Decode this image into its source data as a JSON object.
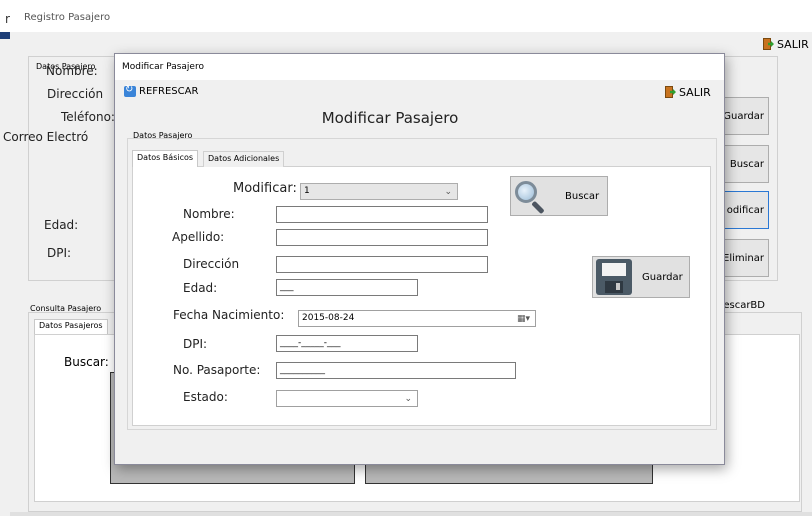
{
  "background_window": {
    "title": "Registro Pasajero",
    "salir_label": "SALIR",
    "datos_legend": "Datos Pasajero",
    "labels": {
      "nombre": "Nombre:",
      "direccion": "Dirección",
      "telefono": "Teléfono:",
      "correo": "Correo Electró",
      "edad": "Edad:",
      "dpi": "DPI:"
    },
    "side_buttons": {
      "guardar": "Guardar",
      "buscar": "Buscar",
      "modificar": "odificar",
      "eliminar": "Eliminar",
      "refrescar_bd": "escarBD"
    },
    "consulta_legend": "Consulta Pasajero",
    "consulta_tab": "Datos Pasajeros",
    "buscar_label": "Buscar:"
  },
  "dialog": {
    "title": "Modificar Pasajero",
    "refrescar_label": "REFRESCAR",
    "salir_label": "SALIR",
    "heading": "Modificar Pasajero",
    "group_legend": "Datos Pasajero",
    "tabs": [
      {
        "label": "Datos Básicos",
        "active": true
      },
      {
        "label": "Datos Adicionales",
        "active": false
      }
    ],
    "form": {
      "modificar_label": "Modificar:",
      "modificar_value": "1",
      "nombre_label": "Nombre:",
      "nombre_value": "",
      "apellido_label": "Apellido:",
      "apellido_value": "",
      "direccion_label": "Dirección",
      "direccion_value": "",
      "edad_label": "Edad:",
      "edad_value": "___",
      "fecha_label": "Fecha  Nacimiento:",
      "fecha_value": "2015-08-24",
      "dpi_label": "DPI:",
      "dpi_value": "____-_____-___",
      "pasaporte_label": "No. Pasaporte:",
      "pasaporte_value": "__________",
      "estado_label": "Estado:",
      "estado_value": ""
    },
    "buttons": {
      "buscar": "Buscar",
      "guardar": "Guardar"
    }
  },
  "colors": {
    "accent_blue": "#1e3f78",
    "focus_border": "#2b78d4",
    "grid_gray": "#b8b8b8"
  }
}
